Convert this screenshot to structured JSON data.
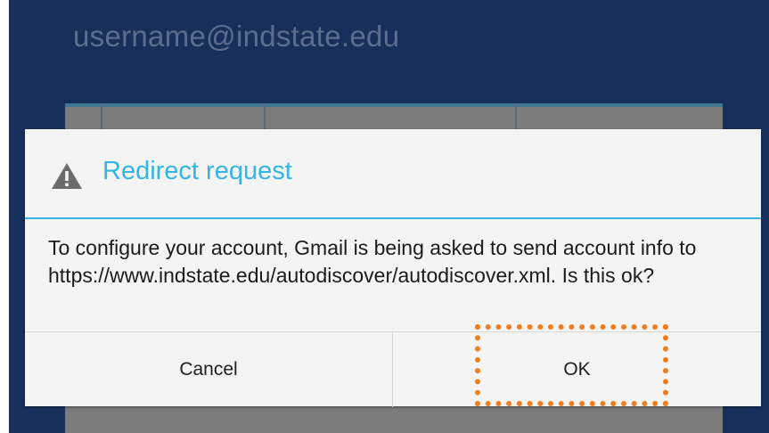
{
  "background": {
    "username_text": "username@indstate.edu",
    "color": "#182f5c"
  },
  "dialog": {
    "icon": "warning-icon",
    "title": "Redirect request",
    "message": "To configure your account, Gmail is being asked to send account info to https://www.indstate.edu/autodiscover/autodiscover.xml. Is this ok?",
    "accent_color": "#33b5e5",
    "buttons": {
      "cancel_label": "Cancel",
      "ok_label": "OK"
    }
  },
  "annotation": {
    "highlight_target": "ok-button",
    "color": "#f07d1f"
  }
}
